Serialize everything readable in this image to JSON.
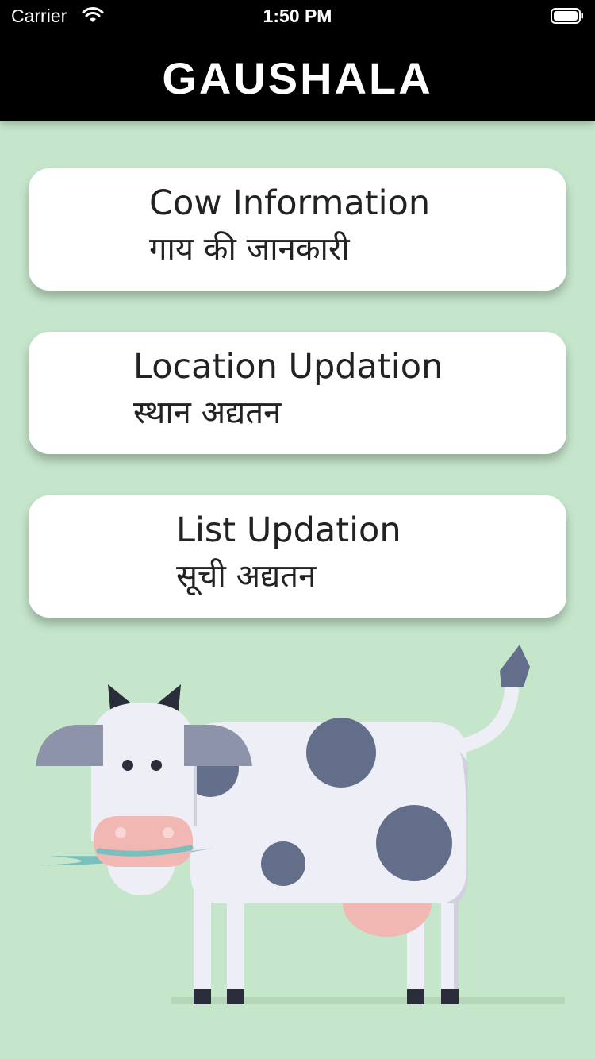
{
  "status_bar": {
    "carrier": "Carrier",
    "time": "1:50 PM"
  },
  "header": {
    "title": "GAUSHALA"
  },
  "menu": [
    {
      "title_en": "Cow Information",
      "title_hi": "गाय की जानकारी"
    },
    {
      "title_en": "Location Updation",
      "title_hi": "स्थान अद्यतन"
    },
    {
      "title_en": "List Updation",
      "title_hi": "सूची अद्यतन"
    }
  ],
  "illustration": {
    "name": "cow-illustration"
  },
  "colors": {
    "background": "#c6e6cb",
    "header": "#000000",
    "card": "#ffffff",
    "cow_body": "#eeeff6",
    "cow_spot": "#636e8a",
    "cow_nose": "#f1b7b2"
  }
}
